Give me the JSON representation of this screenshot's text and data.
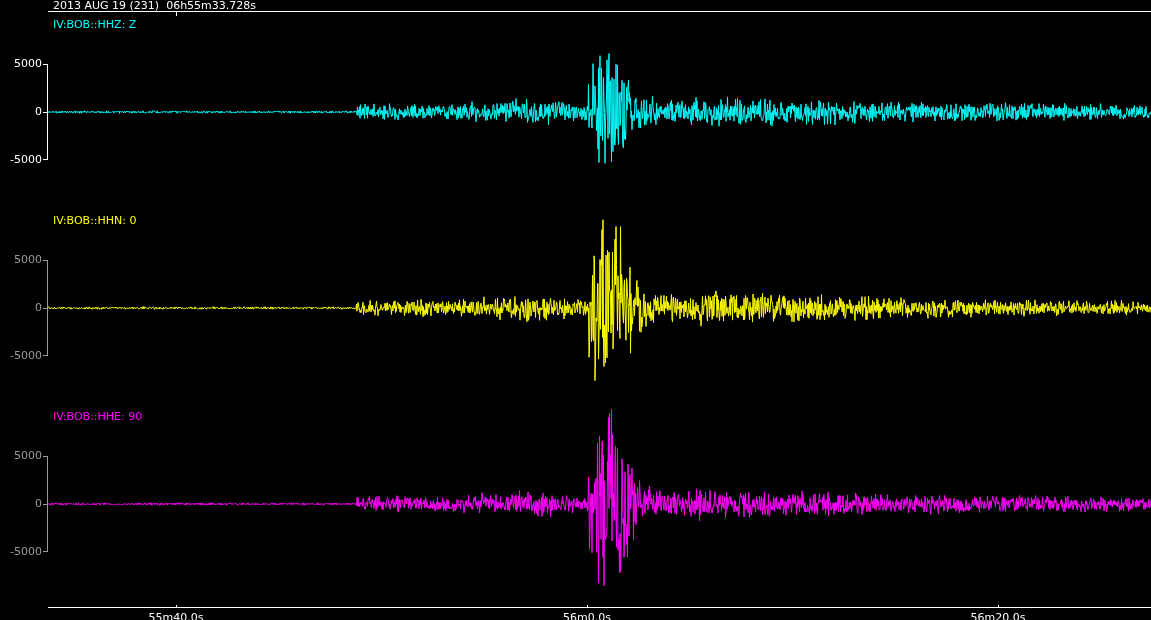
{
  "header": {
    "title": "2013 AUG 19 (231)  06h55m33.728s"
  },
  "traces": [
    {
      "label": "IV:BOB::HHZ: Z",
      "color": "#00ffff",
      "selected": true,
      "yticks": [
        "5000",
        "0",
        "-5000"
      ]
    },
    {
      "label": "IV:BOB::HHN: 0",
      "color": "#ffff00",
      "selected": false,
      "yticks": [
        "5000",
        "0",
        "-5000"
      ]
    },
    {
      "label": "IV:BOB::HHE: 90",
      "color": "#ff00ff",
      "selected": false,
      "yticks": [
        "5000",
        "0",
        "-5000"
      ]
    }
  ],
  "time_axis": {
    "ticks": [
      "55m40.0s",
      "56m0.0s",
      "56m20.0s"
    ]
  }
}
